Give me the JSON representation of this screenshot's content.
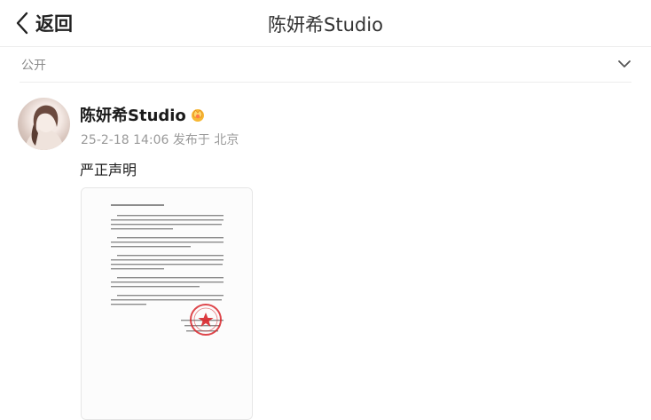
{
  "header": {
    "back_label": "返回",
    "title": "陈妍希Studio"
  },
  "visibility": {
    "label": "公开"
  },
  "post": {
    "author": "陈妍希Studio",
    "meta": "25-2-18 14:06 发布于 北京",
    "text": "严正声明",
    "badge_icon": "verified-crown-icon"
  },
  "colors": {
    "seal_red": "#d8262b",
    "badge_orange": "#f5a623"
  }
}
